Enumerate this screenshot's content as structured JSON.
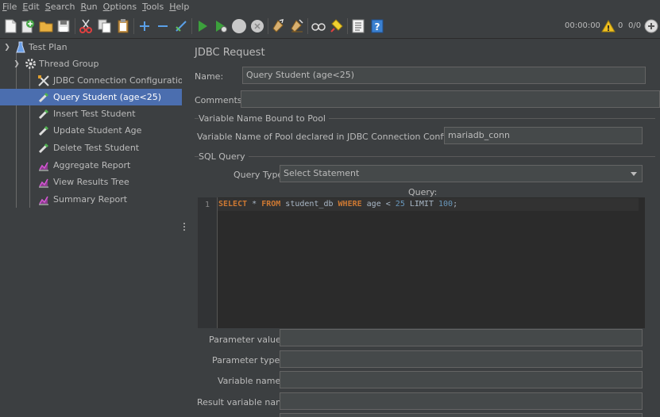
{
  "menu": [
    {
      "mnemonic": "F",
      "rest": "ile"
    },
    {
      "mnemonic": "E",
      "rest": "dit"
    },
    {
      "mnemonic": "S",
      "rest": "earch"
    },
    {
      "mnemonic": "R",
      "rest": "un"
    },
    {
      "mnemonic": "O",
      "rest": "ptions"
    },
    {
      "mnemonic": "T",
      "rest": "ools"
    },
    {
      "mnemonic": "H",
      "rest": "elp"
    }
  ],
  "toolbar": {
    "elapsed": "00:00:00",
    "warning_count": "0",
    "threads": "0/0",
    "icons": [
      "new-icon",
      "templates-icon",
      "open-icon",
      "save-icon",
      "cut-icon",
      "copy-icon",
      "paste-icon",
      "expand-icon",
      "collapse-icon",
      "toggle-icon",
      "start-icon",
      "start-no-pause-icon",
      "stop-icon",
      "shutdown-icon",
      "clear-icon",
      "clear-all-icon",
      "search-icon",
      "reset-search-icon",
      "function-helper-icon",
      "help-icon"
    ]
  },
  "tree": {
    "items": [
      {
        "label": "Test Plan",
        "icon": "test-plan-icon"
      },
      {
        "label": "Thread Group",
        "icon": "thread-group-icon"
      },
      {
        "label": "JDBC Connection Configuration",
        "icon": "config-tools-icon"
      },
      {
        "label": "Query Student (age<25)",
        "icon": "sampler-pipette-icon"
      },
      {
        "label": "Insert Test Student",
        "icon": "sampler-pipette-icon"
      },
      {
        "label": "Update Student Age",
        "icon": "sampler-pipette-icon"
      },
      {
        "label": "Delete Test Student",
        "icon": "sampler-pipette-icon"
      },
      {
        "label": "Aggregate Report",
        "icon": "listener-chart-icon"
      },
      {
        "label": "View Results Tree",
        "icon": "listener-chart-icon"
      },
      {
        "label": "Summary Report",
        "icon": "listener-chart-icon"
      }
    ]
  },
  "form": {
    "title": "JDBC Request",
    "name_label": "Name:",
    "name_value": "Query Student (age<25)",
    "comments_label": "Comments:",
    "comments_value": "",
    "pool_group": "Variable Name Bound to Pool",
    "pool_label": "Variable Name of Pool declared in JDBC Connection Configuration:",
    "pool_value": "mariadb_conn",
    "sql_group": "SQL Query",
    "query_type_label": "Query Type:",
    "query_type_value": "Select Statement",
    "query_label": "Query:",
    "line_number": "1",
    "sql": {
      "select": "SELECT",
      "star": " * ",
      "from": "FROM",
      "table": " student_db ",
      "where": "WHERE",
      "cond": " age < ",
      "age": "25",
      "limit": " LIMIT ",
      "limit_val": "100",
      "end": ";"
    },
    "param_values_label": "Parameter values:",
    "param_types_label": "Parameter types:",
    "var_names_label": "Variable names:",
    "result_var_label": "Result variable name:"
  },
  "colors": {
    "background": "#3c3f41",
    "selection": "#4b6eaf",
    "keyword": "#cc7832",
    "number": "#6897bb"
  }
}
